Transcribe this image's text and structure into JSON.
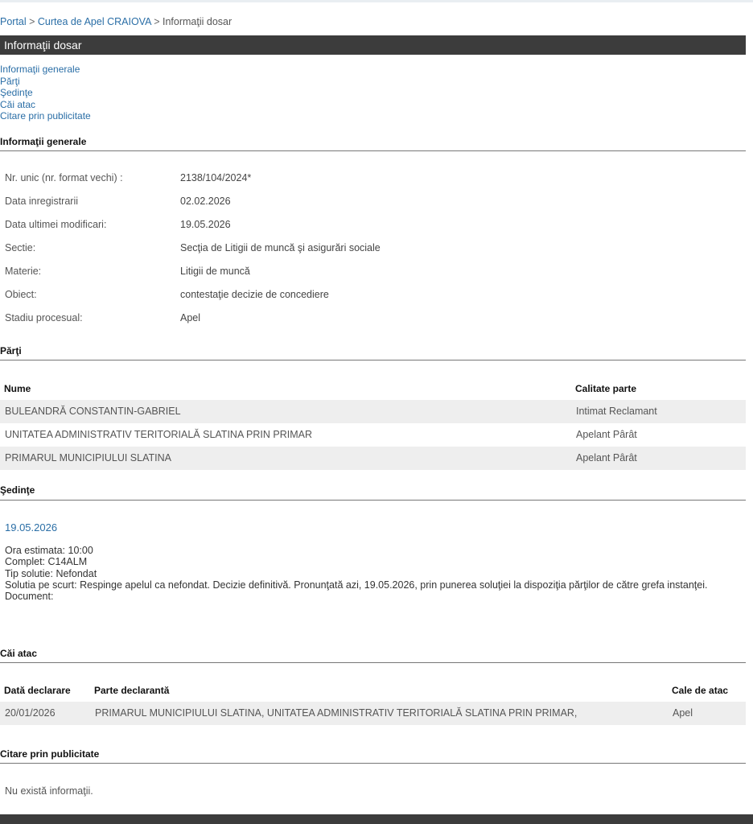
{
  "breadcrumb": {
    "portal": "Portal",
    "sep1": " > ",
    "court": "Curtea de Apel CRAIOVA",
    "sep2": " > ",
    "current": "Informaţii dosar"
  },
  "title": "Informaţii dosar",
  "toc": [
    "Informaţii generale",
    "Părţi",
    "Şedinţe",
    "Căi atac",
    "Citare prin publicitate"
  ],
  "general": {
    "heading": "Informaţii generale",
    "rows": [
      {
        "label": "Nr. unic (nr. format vechi) :",
        "value": "2138/104/2024*"
      },
      {
        "label": "Data inregistrarii",
        "value": "02.02.2026"
      },
      {
        "label": "Data ultimei modificari:",
        "value": "19.05.2026"
      },
      {
        "label": "Sectie:",
        "value": "Secţia de Litigii de muncă şi asigurări sociale"
      },
      {
        "label": "Materie:",
        "value": "Litigii de muncă"
      },
      {
        "label": "Obiect:",
        "value": "contestaţie decizie de concediere"
      },
      {
        "label": "Stadiu procesual:",
        "value": "Apel"
      }
    ]
  },
  "parti": {
    "heading": "Părţi",
    "columns": [
      "Nume",
      "Calitate parte"
    ],
    "rows": [
      {
        "nume": "BULEANDRĂ CONSTANTIN-GABRIEL",
        "calitate": "Intimat Reclamant"
      },
      {
        "nume": "UNITATEA ADMINISTRATIV TERITORIALĂ SLATINA PRIN PRIMAR",
        "calitate": "Apelant Pârât"
      },
      {
        "nume": "PRIMARUL MUNICIPIULUI SLATINA",
        "calitate": "Apelant Pârât"
      }
    ]
  },
  "sedinte": {
    "heading": "Şedinţe",
    "date": "19.05.2026",
    "lines": [
      "Ora estimata: 10:00",
      "Complet: C14ALM",
      "Tip solutie: Nefondat",
      "Solutia pe scurt: Respinge apelul ca nefondat. Decizie definitivă. Pronunţată azi, 19.05.2026, prin punerea soluţiei la dispoziţia părţilor de către grefa instanţei.",
      "Document:"
    ]
  },
  "cai_atac": {
    "heading": "Căi atac",
    "columns": [
      "Dată declarare",
      "Parte declarantă",
      "Cale de atac"
    ],
    "rows": [
      {
        "data": "20/01/2026",
        "parte": "PRIMARUL MUNICIPIULUI SLATINA, UNITATEA ADMINISTRATIV TERITORIALĂ SLATINA PRIN PRIMAR,",
        "cale": "Apel"
      }
    ]
  },
  "citare": {
    "heading": "Citare prin publicitate",
    "empty": "Nu există informaţii."
  }
}
